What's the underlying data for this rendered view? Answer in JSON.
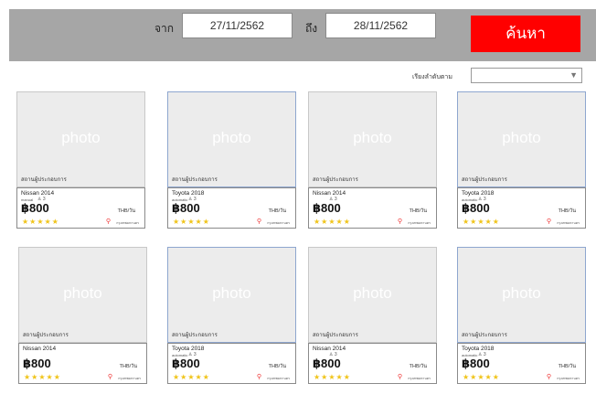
{
  "header": {
    "from_label": "จาก",
    "from_date": "27/11/2562",
    "to_label": "ถึง",
    "to_date": "28/11/2562",
    "search_label": "ค้นหา"
  },
  "sort": {
    "label": "เรียงลำดับตาม",
    "value": ""
  },
  "cards": [
    {
      "photo": "photo",
      "provider": "สถานผู้ประกอบการ",
      "model": "Nissan 2014",
      "spec": "manual",
      "seats": "♙ 3",
      "price": "฿800",
      "unit": "THB/วัน",
      "stars": "★★★★★",
      "location": "กรุงเทพมหานคร"
    },
    {
      "photo": "photo",
      "provider": "สถานผู้ประกอบการ",
      "model": "Toyota 2018",
      "spec": "automatic",
      "seats": "♙ 3",
      "price": "฿800",
      "unit": "THB/วัน",
      "stars": "★★★★★",
      "location": "กรุงเทพมหานคร"
    },
    {
      "photo": "photo",
      "provider": "สถานผู้ประกอบการ",
      "model": "Nissan 2014",
      "spec": "",
      "seats": "♙ 3",
      "price": "฿800",
      "unit": "THB/วัน",
      "stars": "★★★★★",
      "location": "กรุงเทพมหานคร"
    },
    {
      "photo": "photo",
      "provider": "สถานผู้ประกอบการ",
      "model": "Toyota 2018",
      "spec": "automatic",
      "seats": "♙ 3",
      "price": "฿800",
      "unit": "THB/วัน",
      "stars": "★★★★★",
      "location": "กรุงเทพมหานคร"
    },
    {
      "photo": "photo",
      "provider": "สถานผู้ประกอบการ",
      "model": "Nissan 2014",
      "spec": "",
      "seats": "",
      "price": "฿800",
      "unit": "THB/วัน",
      "stars": "★★★★★",
      "location": "กรุงเทพมหานคร"
    },
    {
      "photo": "photo",
      "provider": "สถานผู้ประกอบการ",
      "model": "Toyota 2018",
      "spec": "automatic",
      "seats": "♙ 3",
      "price": "฿800",
      "unit": "THB/วัน",
      "stars": "★★★★★",
      "location": "กรุงเทพมหานคร"
    },
    {
      "photo": "photo",
      "provider": "สถานผู้ประกอบการ",
      "model": "Nissan 2014",
      "spec": "",
      "seats": "♙ 3",
      "price": "฿800",
      "unit": "THB/วัน",
      "stars": "★★★★★",
      "location": "กรุงเทพมหานคร"
    },
    {
      "photo": "photo",
      "provider": "สถานผู้ประกอบการ",
      "model": "Toyota 2018",
      "spec": "automatic",
      "seats": "♙ 3",
      "price": "฿800",
      "unit": "THB/วัน",
      "stars": "★★★★★",
      "location": "กรุงเทพมหานคร"
    }
  ]
}
